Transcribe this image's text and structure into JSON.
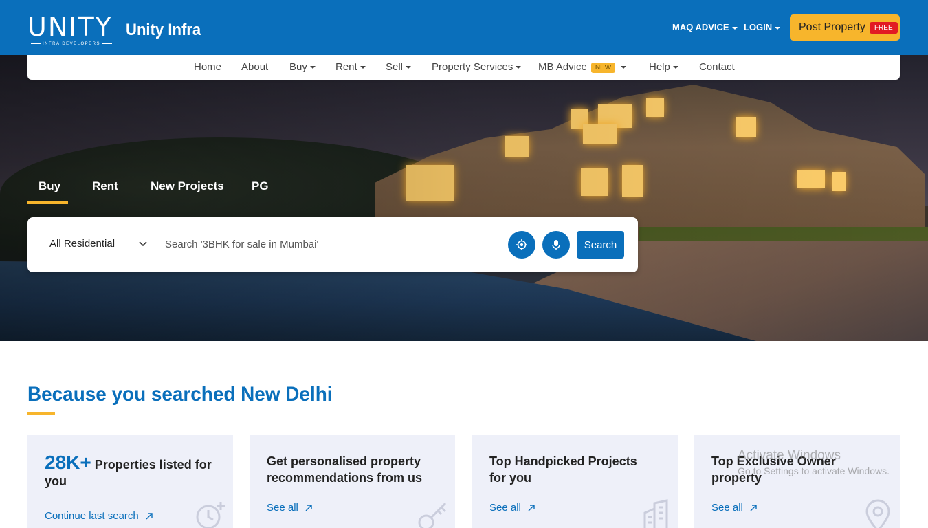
{
  "header": {
    "logo_text": "UNITY",
    "logo_subtext": "INFRA DEVELOPERS",
    "brand_name": "Unity Infra",
    "links": [
      {
        "label": "MAQ ADVICE"
      },
      {
        "label": "LOGIN"
      }
    ],
    "post_property": {
      "label": "Post Property",
      "badge": "FREE"
    },
    "colors": {
      "primary": "#0a6fbb",
      "accent": "#f7b52c",
      "badge": "#e21b23"
    }
  },
  "nav": {
    "items": [
      {
        "label": "Home"
      },
      {
        "label": "About"
      },
      {
        "label": "Buy"
      },
      {
        "label": "Rent"
      },
      {
        "label": "Sell"
      },
      {
        "label": "Property Services"
      },
      {
        "label": "MB Advice",
        "badge": "NEW"
      },
      {
        "label": "Help"
      },
      {
        "label": "Contact"
      }
    ]
  },
  "search": {
    "tabs": [
      {
        "label": "Buy",
        "active": true
      },
      {
        "label": "Rent"
      },
      {
        "label": "New Projects"
      },
      {
        "label": "PG"
      }
    ],
    "property_type": "All Residential",
    "placeholder": "Search '3BHK for sale in Mumbai'",
    "location_icon": "target-icon",
    "mic_icon": "microphone-icon",
    "search_label": "Search"
  },
  "section": {
    "title": "Because you searched New Delhi",
    "cards": [
      {
        "number": "28K+",
        "title": "Properties listed for you",
        "link": "Continue last search",
        "icon": "clock-plus-icon"
      },
      {
        "title": "Get personalised property recommendations from us",
        "link": "See all",
        "icon": "key-icon"
      },
      {
        "title": "Top Handpicked Projects for you",
        "link": "See all",
        "icon": "building-icon"
      },
      {
        "title": "Top Exclusive Owner property",
        "link": "See all",
        "icon": "location-pin-icon"
      }
    ]
  },
  "watermark": {
    "line1": "Activate Windows",
    "line2": "Go to Settings to activate Windows."
  }
}
